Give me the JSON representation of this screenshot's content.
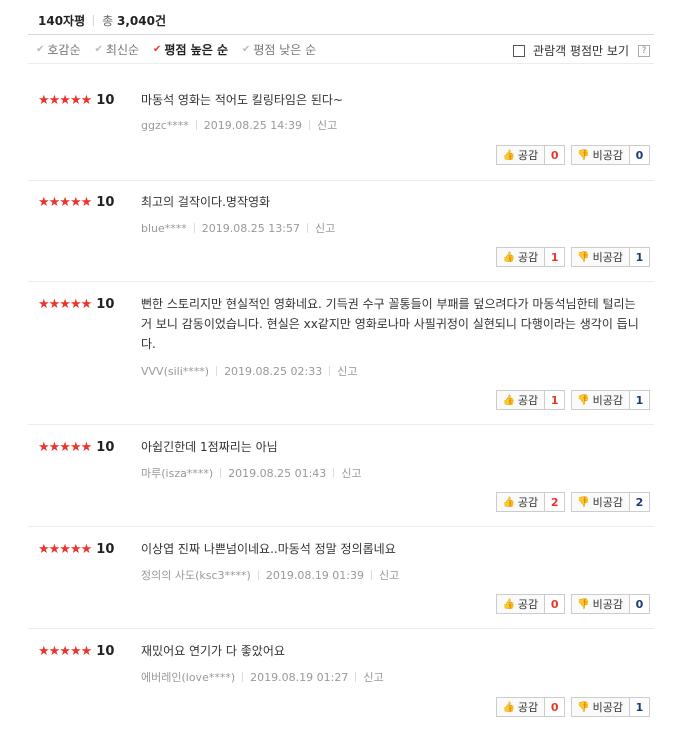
{
  "header": {
    "title": "140자평",
    "total_prefix": "총",
    "total_value": "3,040건"
  },
  "sort": {
    "items": [
      "호감순",
      "최신순",
      "평점 높은 순",
      "평점 낮은 순"
    ],
    "filter_label": "관람객 평점만 보기",
    "help_label": "?"
  },
  "colors": {
    "accent": "#e9352c",
    "down_count": "#1b3a7a"
  },
  "icons": {
    "like": "thumbs-up-icon",
    "dislike": "thumbs-down-icon",
    "star": "star-icon"
  },
  "reviews": [
    {
      "stars": "★★★★★",
      "score": "10",
      "text": "마동석 영화는 적어도 킬링타임은 된다~",
      "user": "ggzc****",
      "date": "2019.08.25 14:39",
      "report": "신고",
      "like_label": "공감",
      "like_count": "0",
      "dislike_label": "비공감",
      "dislike_count": "0"
    },
    {
      "stars": "★★★★★",
      "score": "10",
      "text": "최고의 걸작이다.명작영화",
      "user": "blue****",
      "date": "2019.08.25 13:57",
      "report": "신고",
      "like_label": "공감",
      "like_count": "1",
      "dislike_label": "비공감",
      "dislike_count": "1"
    },
    {
      "stars": "★★★★★",
      "score": "10",
      "text": "뻔한 스토리지만 현실적인 영화네요. 기득권 수구 꼴통들이 부패를 덮으려다가 마동석님한테 털리는 거 보니 감동이었습니다. 현실은 xx같지만 영화로나마 사필귀정이 실현되니 다행이라는 생각이 듭니다.",
      "user": "VVV(sili****)",
      "date": "2019.08.25 02:33",
      "report": "신고",
      "like_label": "공감",
      "like_count": "1",
      "dislike_label": "비공감",
      "dislike_count": "1"
    },
    {
      "stars": "★★★★★",
      "score": "10",
      "text": "아쉽긴한데 1점짜리는 아님",
      "user": "마루(isza****)",
      "date": "2019.08.25 01:43",
      "report": "신고",
      "like_label": "공감",
      "like_count": "2",
      "dislike_label": "비공감",
      "dislike_count": "2"
    },
    {
      "stars": "★★★★★",
      "score": "10",
      "text": "이상엽 진짜 나쁜넘이네요..마동석 정말 정의롭네요",
      "user": "정의의 사도(ksc3****)",
      "date": "2019.08.19 01:39",
      "report": "신고",
      "like_label": "공감",
      "like_count": "0",
      "dislike_label": "비공감",
      "dislike_count": "0"
    },
    {
      "stars": "★★★★★",
      "score": "10",
      "text": "재밌어요 연기가 다 좋았어요",
      "user": "에버레인(love****)",
      "date": "2019.08.19 01:27",
      "report": "신고",
      "like_label": "공감",
      "like_count": "0",
      "dislike_label": "비공감",
      "dislike_count": "1"
    }
  ]
}
